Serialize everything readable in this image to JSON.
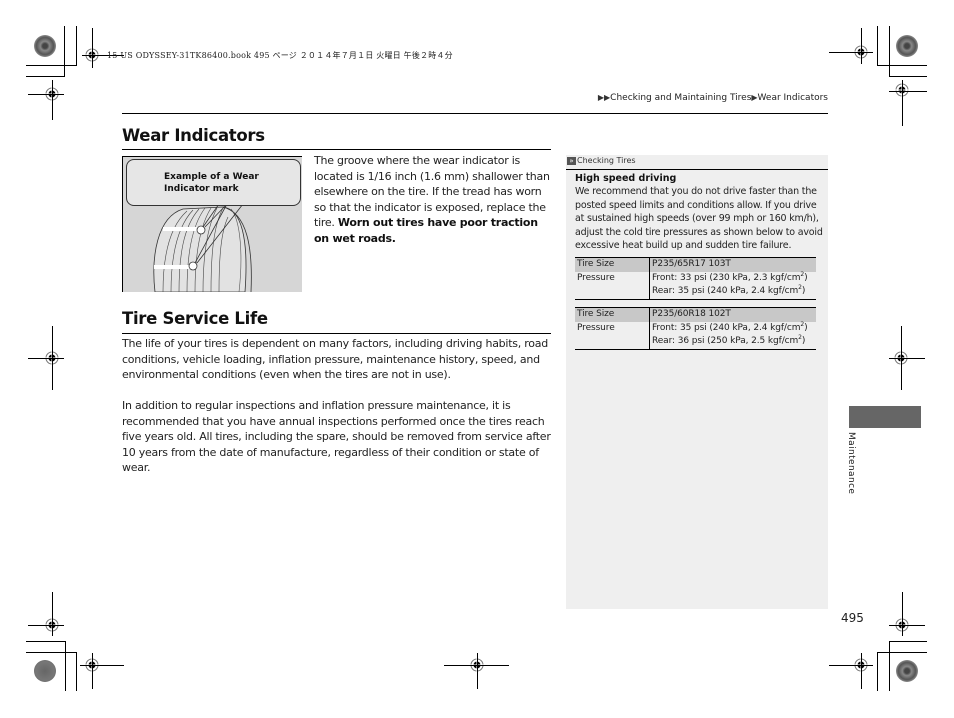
{
  "print_header": "15 US ODYSSEY-31TK86400.book  495 ページ  ２０１４年７月１日  火曜日  午後２時４分",
  "breadcrumb": {
    "arrows_icon": "double-triangle-right",
    "items": [
      "Checking and Maintaining Tires",
      "Wear Indicators"
    ],
    "separator_icon": "triangle-right"
  },
  "wear_indicators": {
    "title": "Wear Indicators",
    "figure_callout": "Example of a Wear Indicator mark",
    "paragraph": "The groove where the wear indicator is located is 1/16 inch (1.6 mm) shallower than elsewhere on the tire. If the tread has worn so that the indicator is exposed, replace the tire.",
    "warning": "Worn out tires have poor traction on wet roads."
  },
  "tire_service_life": {
    "title": "Tire Service Life",
    "paragraphs": [
      "The life of your tires is dependent on many factors, including driving habits, road conditions, vehicle loading, inflation pressure, maintenance history, speed, and environmental conditions (even when the tires are not in use).",
      "In addition to regular inspections and inflation pressure maintenance, it is recommended that you have annual inspections performed once the tires reach five years old. All tires, including the spare, should be removed from service after 10 years from the date of manufacture, regardless of their condition or state of wear."
    ]
  },
  "side_panel": {
    "header_icon": "double-chevron-right",
    "header": "Checking Tires",
    "title": "High speed driving",
    "text": "We recommend that you do not drive faster than the posted speed limits and conditions allow. If you drive at sustained high speeds (over 99 mph or 160 km/h), adjust the cold tire pressures as shown below to avoid excessive heat build up and sudden tire failure.",
    "tables": [
      {
        "size_label": "Tire Size",
        "size": "P235/65R17 103T",
        "pressure_label": "Pressure",
        "front": "Front: 33 psi (230 kPa, 2.3 kgf/cm",
        "rear": "Rear: 35 psi (240 kPa, 2.4 kgf/cm",
        "unit_sup": "2",
        "close": ")"
      },
      {
        "size_label": "Tire Size",
        "size": "P235/60R18 102T",
        "pressure_label": "Pressure",
        "front": "Front: 35 psi (240 kPa, 2.4 kgf/cm",
        "rear": "Rear: 36 psi (250 kPa, 2.5 kgf/cm",
        "unit_sup": "2",
        "close": ")"
      }
    ]
  },
  "section_tab": "Maintenance",
  "page_number": "495",
  "colors": {
    "panel_bg": "#efefef",
    "table_header_bg": "#c8c8c8",
    "tab_bg": "#666666",
    "figure_bg": "#d6d6d6"
  }
}
